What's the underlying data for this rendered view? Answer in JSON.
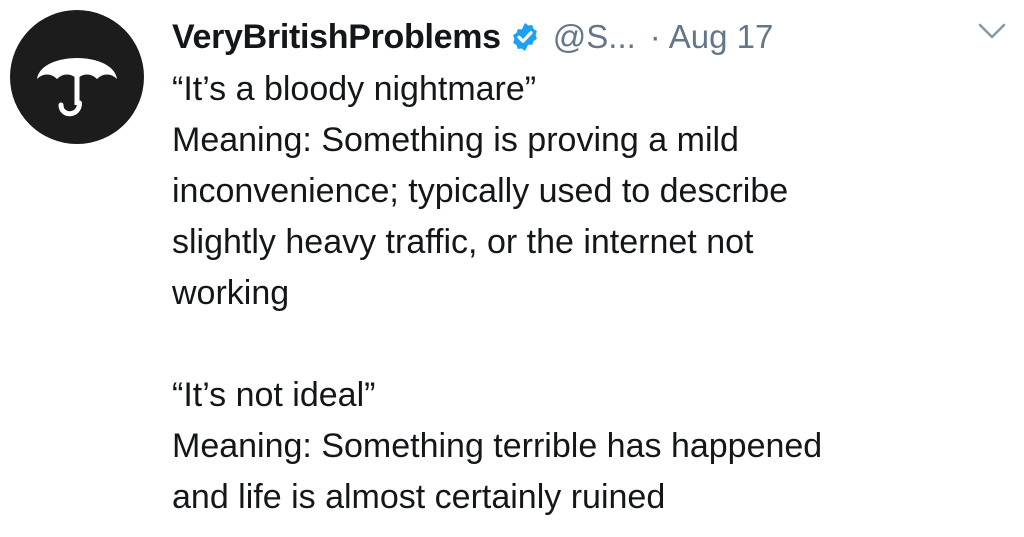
{
  "author": {
    "display_name": "VeryBritishProblems",
    "handle": "@S...",
    "verified_icon": "verified-badge-icon",
    "avatar_icon": "umbrella-icon"
  },
  "meta": {
    "separator": "·",
    "timestamp": "Aug 17",
    "menu_icon": "chevron-down-icon"
  },
  "tweet": {
    "lines_block1": [
      "“It’s a bloody nightmare”",
      "Meaning: Something is proving a mild",
      "inconvenience; typically used to describe",
      "slightly heavy traffic, or the internet not",
      "working"
    ],
    "lines_block2": [
      "“It’s not ideal”",
      "Meaning: Something terrible has happened",
      "and life is almost certainly ruined"
    ]
  },
  "colors": {
    "text": "#14171a",
    "secondary": "#657786",
    "verified": "#1da1f2",
    "avatar_bg": "#1c1c1c"
  }
}
